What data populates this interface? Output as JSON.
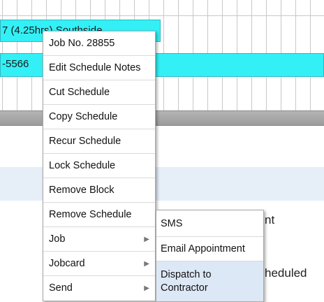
{
  "schedule": {
    "bar1_text": "7 (4.25hrs) Southside",
    "bar2_text": "-5566"
  },
  "background": {
    "peek1_text": "nt",
    "peek2_text": "heduled"
  },
  "context_menu": {
    "items": [
      {
        "label": "Job No. 28855"
      },
      {
        "label": "Edit Schedule Notes"
      },
      {
        "label": "Cut Schedule"
      },
      {
        "label": "Copy Schedule"
      },
      {
        "label": "Recur Schedule"
      },
      {
        "label": "Lock Schedule"
      },
      {
        "label": "Remove Block"
      },
      {
        "label": "Remove Schedule"
      },
      {
        "label": "Job",
        "submenu_arrow": "▶"
      },
      {
        "label": "Jobcard",
        "submenu_arrow": "▶"
      },
      {
        "label": "Send",
        "submenu_arrow": "▶"
      }
    ]
  },
  "send_submenu": {
    "items": [
      {
        "label": "SMS"
      },
      {
        "label": "Email Appointment"
      },
      {
        "label": "Dispatch to\nContractor",
        "highlighted": true
      }
    ]
  },
  "colors": {
    "bar_fill": "#33f0f6",
    "highlight": "#dde8f6",
    "band": "#e6eef8"
  }
}
